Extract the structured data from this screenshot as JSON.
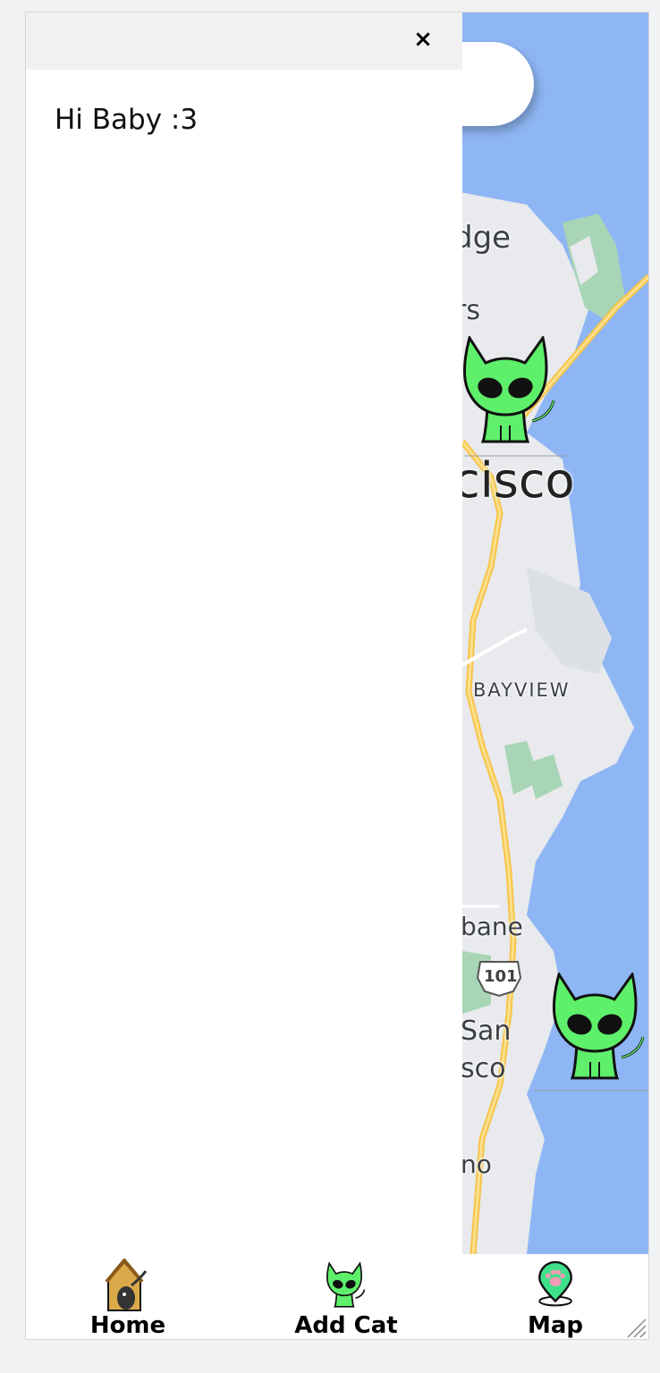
{
  "drawer": {
    "close_symbol": "×",
    "greeting": "Hi Baby :3"
  },
  "map": {
    "labels": {
      "bridge": "dge",
      "piers": "rs",
      "city": "cisco",
      "neighborhood": "BAYVIEW",
      "brisbane": "bane",
      "highway": "101",
      "ssf_line1": "San",
      "ssf_line2": "sco",
      "bruno": "no"
    },
    "colors": {
      "water": "#8fb6f4",
      "land": "#e8eaed",
      "park": "#a8d5b5",
      "highway": "#f7c44a",
      "cat_body": "#5ef06a"
    }
  },
  "nav": {
    "items": [
      {
        "label": "Home",
        "icon": "cat-house-icon"
      },
      {
        "label": "Add Cat",
        "icon": "green-cat-icon"
      },
      {
        "label": "Map",
        "icon": "map-pin-paw-icon"
      }
    ]
  }
}
